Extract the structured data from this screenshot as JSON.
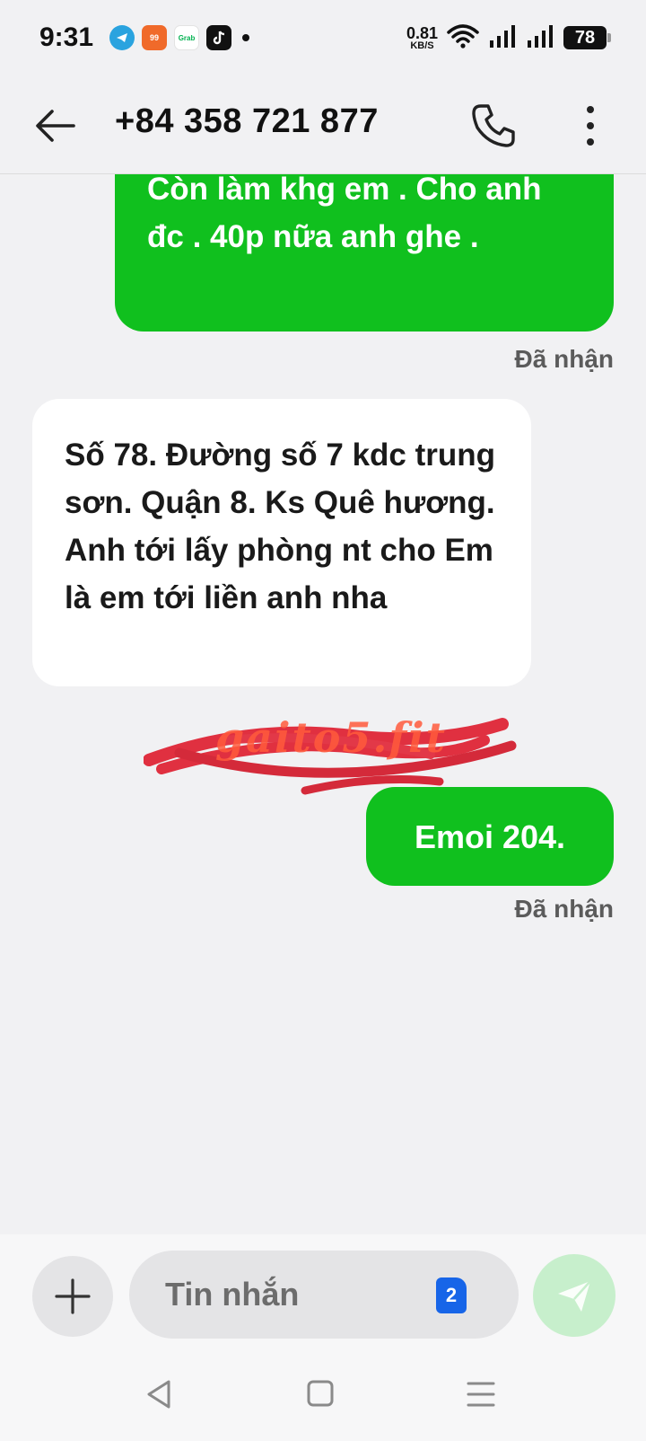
{
  "status_bar": {
    "time": "9:31",
    "app_icons": [
      "telegram-icon",
      "shopee-icon",
      "grab-icon",
      "tiktok-icon"
    ],
    "shopee_badge": "99",
    "grab_label": "Grab",
    "net_speed_value": "0.81",
    "net_speed_unit": "KB/S",
    "battery": "78"
  },
  "header": {
    "title": "+84 358 721 877"
  },
  "messages": [
    {
      "direction": "outgoing",
      "text": "Còn làm khg em . Cho anh đc . 40p nữa anh ghe .",
      "receipt": "Đã nhận"
    },
    {
      "direction": "incoming",
      "text": "Số 78. Đường số 7 kdc trung sơn. Quận 8. Ks Quê hương. Anh tới lấy phòng nt cho Em là em tới liền anh nha"
    },
    {
      "direction": "outgoing",
      "text": "Emoi 204.",
      "receipt": "Đã nhận"
    }
  ],
  "watermark": "gaito5.fit",
  "composer": {
    "placeholder": "Tin nhắn",
    "sim_slot": "2"
  },
  "colors": {
    "outgoing_bubble": "#10c01e",
    "incoming_bubble": "#ffffff",
    "background": "#f1f1f3",
    "sim_badge": "#1765e8",
    "send_button": "#c7efcc"
  }
}
